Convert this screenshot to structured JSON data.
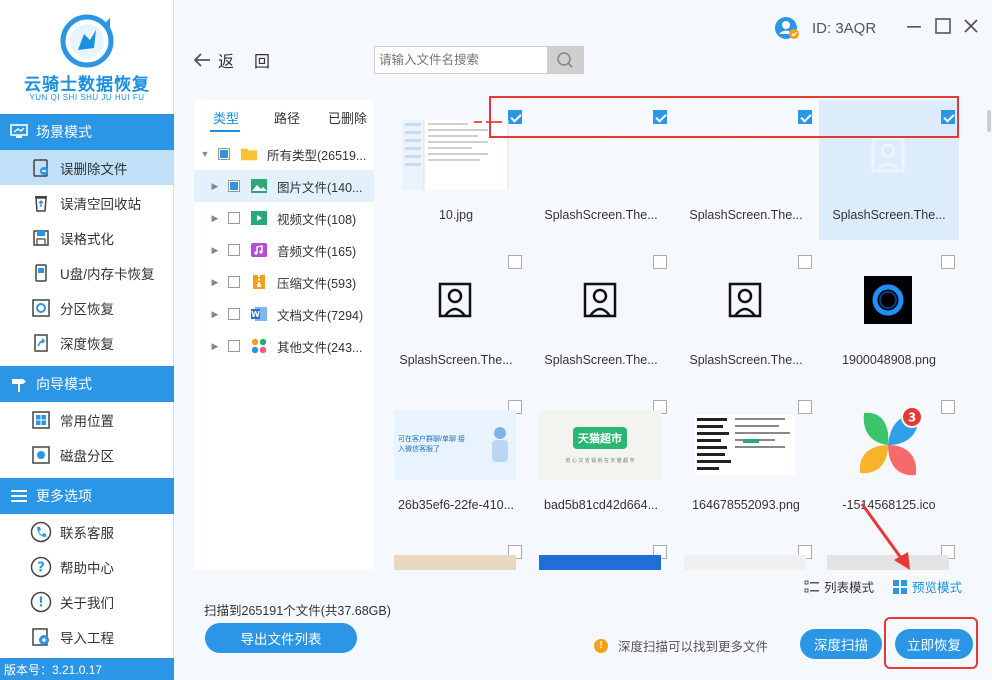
{
  "app": {
    "name": "云骑士数据恢复",
    "pinyin": "YUN QI SHI SHU JU HUI FU",
    "id_label": "ID: 3AQR",
    "version": "版本号：3.21.0.17"
  },
  "sidebar": {
    "sections": [
      {
        "label": "场景模式",
        "items": [
          {
            "label": "误删除文件",
            "icon": "deleted-file-icon",
            "active": true
          },
          {
            "label": "误清空回收站",
            "icon": "recycle-bin-icon"
          },
          {
            "label": "误格式化",
            "icon": "format-disk-icon"
          },
          {
            "label": "U盘/内存卡恢复",
            "icon": "usb-drive-icon"
          },
          {
            "label": "分区恢复",
            "icon": "partition-icon"
          },
          {
            "label": "深度恢复",
            "icon": "deep-recovery-icon"
          }
        ]
      },
      {
        "label": "向导模式",
        "items": [
          {
            "label": "常用位置",
            "icon": "windows-icon"
          },
          {
            "label": "磁盘分区",
            "icon": "disk-partition-icon"
          }
        ]
      },
      {
        "label": "更多选项",
        "items": [
          {
            "label": "联系客服",
            "icon": "phone-icon"
          },
          {
            "label": "帮助中心",
            "icon": "help-icon"
          },
          {
            "label": "关于我们",
            "icon": "info-icon"
          },
          {
            "label": "导入工程",
            "icon": "import-icon"
          }
        ]
      }
    ]
  },
  "toolbar": {
    "back_label": "返回",
    "search_placeholder": "请输入文件名搜索"
  },
  "tree": {
    "tabs": [
      "类型",
      "路径",
      "已删除"
    ],
    "active_tab": 0,
    "root": "所有类型(26519...",
    "items": [
      {
        "label": "图片文件(140...",
        "icon": "image-icon",
        "selected": true
      },
      {
        "label": "视频文件(108)",
        "icon": "video-icon"
      },
      {
        "label": "音频文件(165)",
        "icon": "audio-icon"
      },
      {
        "label": "压缩文件(593)",
        "icon": "zip-icon"
      },
      {
        "label": "文档文件(7294)",
        "icon": "document-icon"
      },
      {
        "label": "其他文件(243...",
        "icon": "other-files-icon"
      }
    ]
  },
  "files": [
    {
      "name": "10.jpg",
      "thumb": "screenshot",
      "checked": true
    },
    {
      "name": "SplashScreen.The...",
      "thumb": "user-faded",
      "checked": true
    },
    {
      "name": "SplashScreen.The...",
      "thumb": "user-faded",
      "checked": true
    },
    {
      "name": "SplashScreen.The...",
      "thumb": "user-faded",
      "checked": true,
      "highlighted": true
    },
    {
      "name": "SplashScreen.The...",
      "thumb": "user",
      "checked": false
    },
    {
      "name": "SplashScreen.The...",
      "thumb": "user",
      "checked": false
    },
    {
      "name": "SplashScreen.The...",
      "thumb": "user",
      "checked": false
    },
    {
      "name": "1900048908.png",
      "thumb": "cortana",
      "checked": false
    },
    {
      "name": "26b35ef6-22fe-410...",
      "thumb": "banner-blue",
      "checked": false
    },
    {
      "name": "bad5b81cd42d664...",
      "thumb": "tmall",
      "checked": false
    },
    {
      "name": "164678552093.png",
      "thumb": "table",
      "checked": false
    },
    {
      "name": "-1514568125.ico",
      "thumb": "flower",
      "checked": false
    },
    {
      "name": "",
      "thumb": "partial-tan",
      "checked": false
    },
    {
      "name": "",
      "thumb": "partial-blue",
      "checked": false
    },
    {
      "name": "",
      "thumb": "partial-doc",
      "checked": false
    },
    {
      "name": "",
      "thumb": "partial-gray",
      "checked": false
    }
  ],
  "thumb_texts": {
    "banner": "可在客户群聊/单聊 接入微信客服了",
    "tmall": "天猫超市",
    "tmall_sub": "省 心 又 省 钱 就 在 天 猫 超 市",
    "badge": "3"
  },
  "view_modes": [
    {
      "label": "列表模式",
      "active": false
    },
    {
      "label": "预览模式",
      "active": true
    }
  ],
  "footer": {
    "scan_info": "扫描到265191个文件(共37.68GB)",
    "export_label": "导出文件列表",
    "hint": "深度扫描可以找到更多文件",
    "deep_scan_label": "深度扫描",
    "recover_label": "立即恢复"
  },
  "colors": {
    "primary": "#2b95e6",
    "highlight_red": "#e53935"
  }
}
